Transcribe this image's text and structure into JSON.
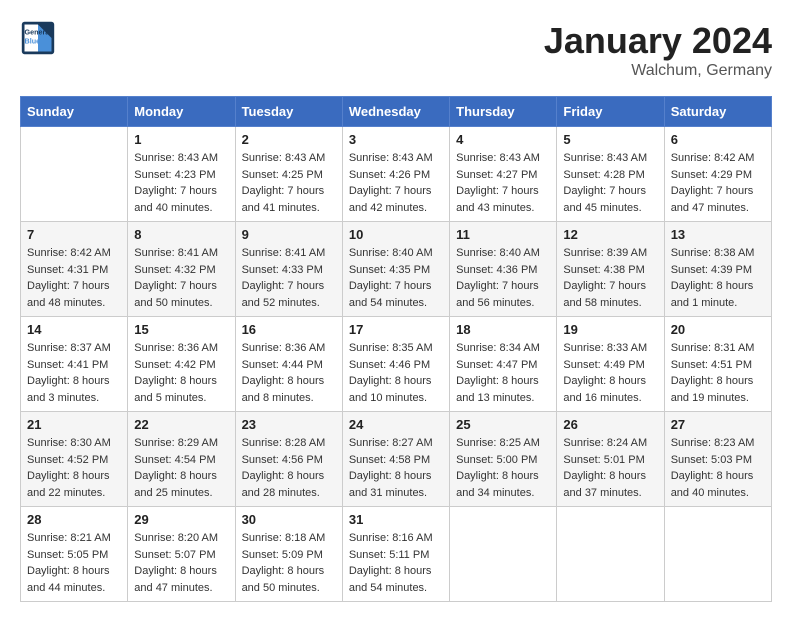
{
  "header": {
    "logo_line1": "General",
    "logo_line2": "Blue",
    "month_title": "January 2024",
    "location": "Walchum, Germany"
  },
  "days_of_week": [
    "Sunday",
    "Monday",
    "Tuesday",
    "Wednesday",
    "Thursday",
    "Friday",
    "Saturday"
  ],
  "weeks": [
    [
      {
        "day": "",
        "sunrise": "",
        "sunset": "",
        "daylight": ""
      },
      {
        "day": "1",
        "sunrise": "Sunrise: 8:43 AM",
        "sunset": "Sunset: 4:23 PM",
        "daylight": "Daylight: 7 hours and 40 minutes."
      },
      {
        "day": "2",
        "sunrise": "Sunrise: 8:43 AM",
        "sunset": "Sunset: 4:25 PM",
        "daylight": "Daylight: 7 hours and 41 minutes."
      },
      {
        "day": "3",
        "sunrise": "Sunrise: 8:43 AM",
        "sunset": "Sunset: 4:26 PM",
        "daylight": "Daylight: 7 hours and 42 minutes."
      },
      {
        "day": "4",
        "sunrise": "Sunrise: 8:43 AM",
        "sunset": "Sunset: 4:27 PM",
        "daylight": "Daylight: 7 hours and 43 minutes."
      },
      {
        "day": "5",
        "sunrise": "Sunrise: 8:43 AM",
        "sunset": "Sunset: 4:28 PM",
        "daylight": "Daylight: 7 hours and 45 minutes."
      },
      {
        "day": "6",
        "sunrise": "Sunrise: 8:42 AM",
        "sunset": "Sunset: 4:29 PM",
        "daylight": "Daylight: 7 hours and 47 minutes."
      }
    ],
    [
      {
        "day": "7",
        "sunrise": "Sunrise: 8:42 AM",
        "sunset": "Sunset: 4:31 PM",
        "daylight": "Daylight: 7 hours and 48 minutes."
      },
      {
        "day": "8",
        "sunrise": "Sunrise: 8:41 AM",
        "sunset": "Sunset: 4:32 PM",
        "daylight": "Daylight: 7 hours and 50 minutes."
      },
      {
        "day": "9",
        "sunrise": "Sunrise: 8:41 AM",
        "sunset": "Sunset: 4:33 PM",
        "daylight": "Daylight: 7 hours and 52 minutes."
      },
      {
        "day": "10",
        "sunrise": "Sunrise: 8:40 AM",
        "sunset": "Sunset: 4:35 PM",
        "daylight": "Daylight: 7 hours and 54 minutes."
      },
      {
        "day": "11",
        "sunrise": "Sunrise: 8:40 AM",
        "sunset": "Sunset: 4:36 PM",
        "daylight": "Daylight: 7 hours and 56 minutes."
      },
      {
        "day": "12",
        "sunrise": "Sunrise: 8:39 AM",
        "sunset": "Sunset: 4:38 PM",
        "daylight": "Daylight: 7 hours and 58 minutes."
      },
      {
        "day": "13",
        "sunrise": "Sunrise: 8:38 AM",
        "sunset": "Sunset: 4:39 PM",
        "daylight": "Daylight: 8 hours and 1 minute."
      }
    ],
    [
      {
        "day": "14",
        "sunrise": "Sunrise: 8:37 AM",
        "sunset": "Sunset: 4:41 PM",
        "daylight": "Daylight: 8 hours and 3 minutes."
      },
      {
        "day": "15",
        "sunrise": "Sunrise: 8:36 AM",
        "sunset": "Sunset: 4:42 PM",
        "daylight": "Daylight: 8 hours and 5 minutes."
      },
      {
        "day": "16",
        "sunrise": "Sunrise: 8:36 AM",
        "sunset": "Sunset: 4:44 PM",
        "daylight": "Daylight: 8 hours and 8 minutes."
      },
      {
        "day": "17",
        "sunrise": "Sunrise: 8:35 AM",
        "sunset": "Sunset: 4:46 PM",
        "daylight": "Daylight: 8 hours and 10 minutes."
      },
      {
        "day": "18",
        "sunrise": "Sunrise: 8:34 AM",
        "sunset": "Sunset: 4:47 PM",
        "daylight": "Daylight: 8 hours and 13 minutes."
      },
      {
        "day": "19",
        "sunrise": "Sunrise: 8:33 AM",
        "sunset": "Sunset: 4:49 PM",
        "daylight": "Daylight: 8 hours and 16 minutes."
      },
      {
        "day": "20",
        "sunrise": "Sunrise: 8:31 AM",
        "sunset": "Sunset: 4:51 PM",
        "daylight": "Daylight: 8 hours and 19 minutes."
      }
    ],
    [
      {
        "day": "21",
        "sunrise": "Sunrise: 8:30 AM",
        "sunset": "Sunset: 4:52 PM",
        "daylight": "Daylight: 8 hours and 22 minutes."
      },
      {
        "day": "22",
        "sunrise": "Sunrise: 8:29 AM",
        "sunset": "Sunset: 4:54 PM",
        "daylight": "Daylight: 8 hours and 25 minutes."
      },
      {
        "day": "23",
        "sunrise": "Sunrise: 8:28 AM",
        "sunset": "Sunset: 4:56 PM",
        "daylight": "Daylight: 8 hours and 28 minutes."
      },
      {
        "day": "24",
        "sunrise": "Sunrise: 8:27 AM",
        "sunset": "Sunset: 4:58 PM",
        "daylight": "Daylight: 8 hours and 31 minutes."
      },
      {
        "day": "25",
        "sunrise": "Sunrise: 8:25 AM",
        "sunset": "Sunset: 5:00 PM",
        "daylight": "Daylight: 8 hours and 34 minutes."
      },
      {
        "day": "26",
        "sunrise": "Sunrise: 8:24 AM",
        "sunset": "Sunset: 5:01 PM",
        "daylight": "Daylight: 8 hours and 37 minutes."
      },
      {
        "day": "27",
        "sunrise": "Sunrise: 8:23 AM",
        "sunset": "Sunset: 5:03 PM",
        "daylight": "Daylight: 8 hours and 40 minutes."
      }
    ],
    [
      {
        "day": "28",
        "sunrise": "Sunrise: 8:21 AM",
        "sunset": "Sunset: 5:05 PM",
        "daylight": "Daylight: 8 hours and 44 minutes."
      },
      {
        "day": "29",
        "sunrise": "Sunrise: 8:20 AM",
        "sunset": "Sunset: 5:07 PM",
        "daylight": "Daylight: 8 hours and 47 minutes."
      },
      {
        "day": "30",
        "sunrise": "Sunrise: 8:18 AM",
        "sunset": "Sunset: 5:09 PM",
        "daylight": "Daylight: 8 hours and 50 minutes."
      },
      {
        "day": "31",
        "sunrise": "Sunrise: 8:16 AM",
        "sunset": "Sunset: 5:11 PM",
        "daylight": "Daylight: 8 hours and 54 minutes."
      },
      {
        "day": "",
        "sunrise": "",
        "sunset": "",
        "daylight": ""
      },
      {
        "day": "",
        "sunrise": "",
        "sunset": "",
        "daylight": ""
      },
      {
        "day": "",
        "sunrise": "",
        "sunset": "",
        "daylight": ""
      }
    ]
  ]
}
